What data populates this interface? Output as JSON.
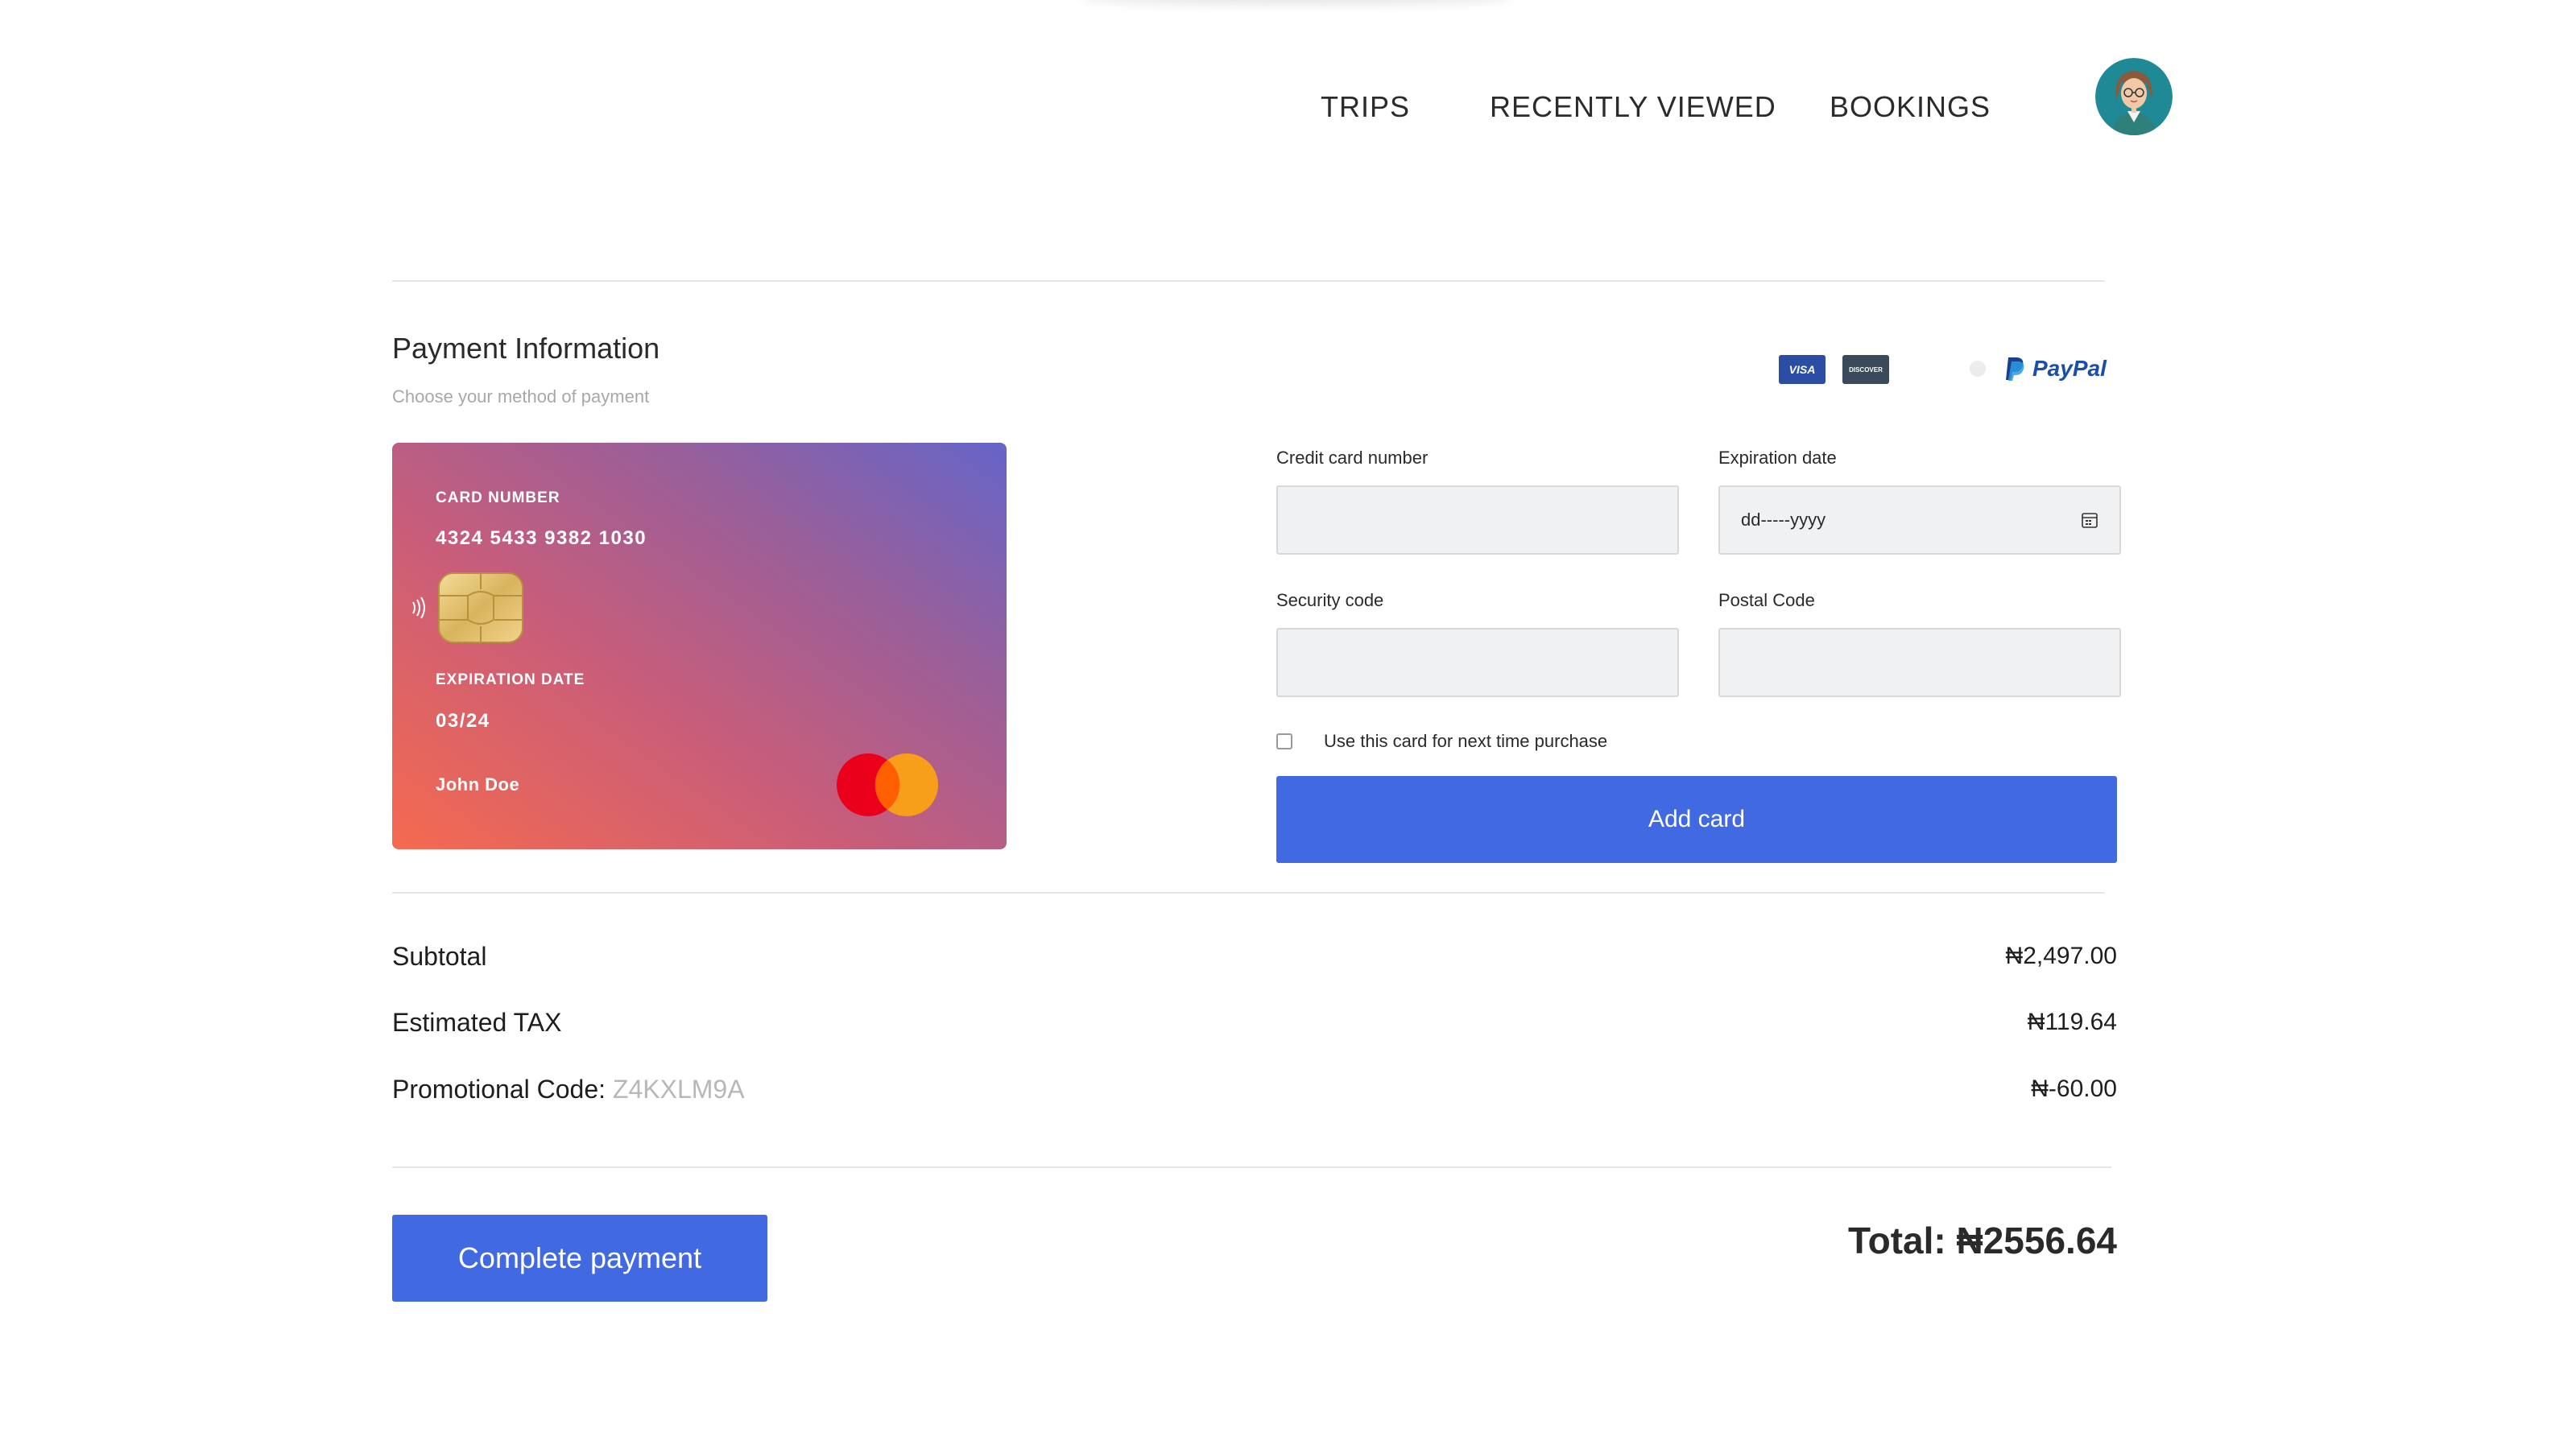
{
  "nav": {
    "items": [
      "TRIPS",
      "RECENTLY VIEWED",
      "BOOKINGS"
    ]
  },
  "payment": {
    "title": "Payment Information",
    "subtitle": "Choose your method of payment",
    "methods": {
      "visa": "VISA",
      "discover": "DISCOVER",
      "paypal": "PayPal"
    }
  },
  "card": {
    "number_label": "CARD NUMBER",
    "number": "4324 5433 9382 1030",
    "expiry_label": "EXPIRATION DATE",
    "expiry": "03/24",
    "holder": "John Doe"
  },
  "form": {
    "card_number_label": "Credit card number",
    "card_number_value": "",
    "expiration_label": "Expiration date",
    "expiration_placeholder": "dd-----yyyy",
    "security_label": "Security code",
    "security_value": "",
    "postal_label": "Postal Code",
    "postal_value": "",
    "save_card_label": "Use this card for next time purchase",
    "save_card_checked": false,
    "add_card_button": "Add card"
  },
  "summary": {
    "subtotal_label": "Subtotal",
    "subtotal_value": "₦2,497.00",
    "tax_label": "Estimated TAX",
    "tax_value": "₦119.64",
    "promo_label": "Promotional Code: ",
    "promo_code": "Z4KXLM9A",
    "promo_value": "₦-60.00",
    "complete_button": "Complete payment",
    "total": "Total: ₦2556.64"
  },
  "colors": {
    "accent": "#4169e1",
    "card_gradient_start": "#f56a4f",
    "card_gradient_end": "#6565c8"
  }
}
